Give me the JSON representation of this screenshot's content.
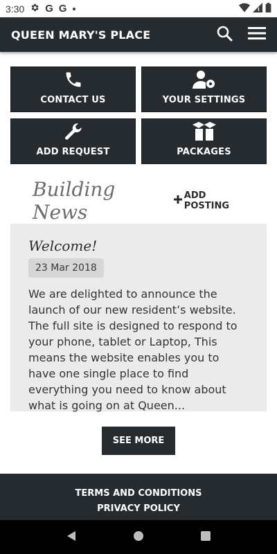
{
  "status_bar": {
    "time": "3:30",
    "icons": [
      "gear-icon",
      "google-icon",
      "google-icon",
      "dot-icon",
      "wifi-icon",
      "signal-icon",
      "battery-icon"
    ]
  },
  "app_bar": {
    "title": "QUEEN MARY'S PLACE",
    "search_icon": "search-icon",
    "menu_icon": "hamburger-menu-icon"
  },
  "tiles": [
    {
      "label": "CONTACT US",
      "icon": "phone-icon"
    },
    {
      "label": "YOUR SETTINGS",
      "icon": "user-settings-icon"
    },
    {
      "label": "ADD REQUEST",
      "icon": "wrench-icon"
    },
    {
      "label": "PACKAGES",
      "icon": "box-icon"
    }
  ],
  "news": {
    "section_title": "Building News",
    "add_posting_label": "ADD POSTING",
    "post": {
      "title": "Welcome!",
      "date": "23 Mar 2018",
      "excerpt": "We are delighted to announce the launch of our new resident’s website. The full site is designed to respond to your phone, tablet or Laptop, This means the website enables you to have one single place to find everything you need to know about what is going on at Queen..."
    },
    "see_more_label": "SEE MORE"
  },
  "footer": {
    "links": [
      "TERMS AND CONDITIONS",
      "PRIVACY POLICY"
    ]
  },
  "colors": {
    "dark": "#262b30",
    "card_bg": "#ebebeb",
    "news_title": "#6d6d6d"
  }
}
